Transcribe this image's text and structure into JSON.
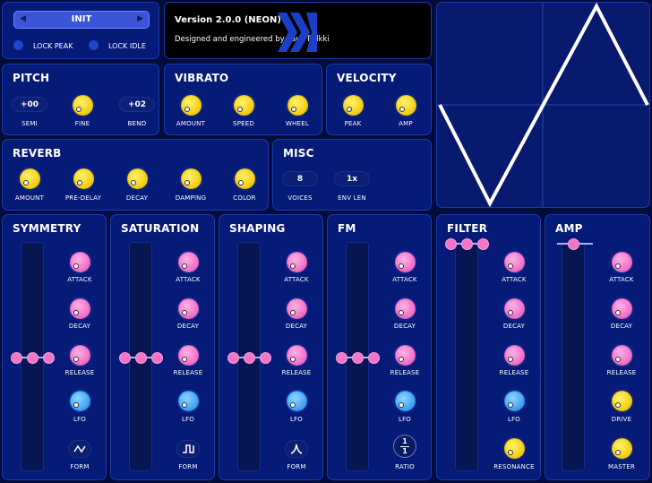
{
  "preset": {
    "name": "INIT",
    "prev": "◀",
    "next": "▶"
  },
  "toggles": [
    {
      "label": "LOCK PEAK"
    },
    {
      "label": "LOCK IDLE"
    }
  ],
  "info": {
    "version": "Version 2.0.0 (NEON)",
    "credit": "Designed and engineered by Pauli Pölkki"
  },
  "pitch": {
    "title": "PITCH",
    "semi_value": "+00",
    "semi_label": "SEMI",
    "fine_label": "FINE",
    "bend_value": "+02",
    "bend_label": "BEND"
  },
  "vibrato": {
    "title": "VIBRATO",
    "labels": [
      "AMOUNT",
      "SPEED",
      "WHEEL"
    ]
  },
  "velocity": {
    "title": "VELOCITY",
    "labels": [
      "PEAK",
      "AMP"
    ]
  },
  "reverb": {
    "title": "REVERB",
    "labels": [
      "AMOUNT",
      "PRE-DELAY",
      "DECAY",
      "DAMPING",
      "COLOR"
    ]
  },
  "misc": {
    "title": "MISC",
    "voices_value": "8",
    "voices_label": "VOICES",
    "env_value": "1x",
    "env_label": "ENV LEN"
  },
  "env": {
    "attack": "ATTACK",
    "decay": "DECAY",
    "release": "RELEASE",
    "lfo": "LFO",
    "form": "FORM",
    "ratio": "RATIO",
    "resonance": "RESONANCE",
    "drive": "DRIVE",
    "master": "MASTER"
  },
  "modules": [
    {
      "title": "SYMMETRY"
    },
    {
      "title": "SATURATION"
    },
    {
      "title": "SHAPING"
    },
    {
      "title": "FM"
    },
    {
      "title": "FILTER"
    },
    {
      "title": "AMP"
    }
  ],
  "ratio_display": {
    "num": "1",
    "den": "1"
  },
  "colors": {
    "bg": "#000c3a",
    "panel": "#061a78",
    "yellow": "#f3cc17",
    "pink": "#f06ec8",
    "blue": "#3fa2f0",
    "wave": "#ffffff"
  },
  "icons": [
    "chevron-left-icon",
    "chevron-right-icon",
    "logo-icon",
    "triangle-form-icon",
    "square-form-icon",
    "peak-form-icon"
  ]
}
